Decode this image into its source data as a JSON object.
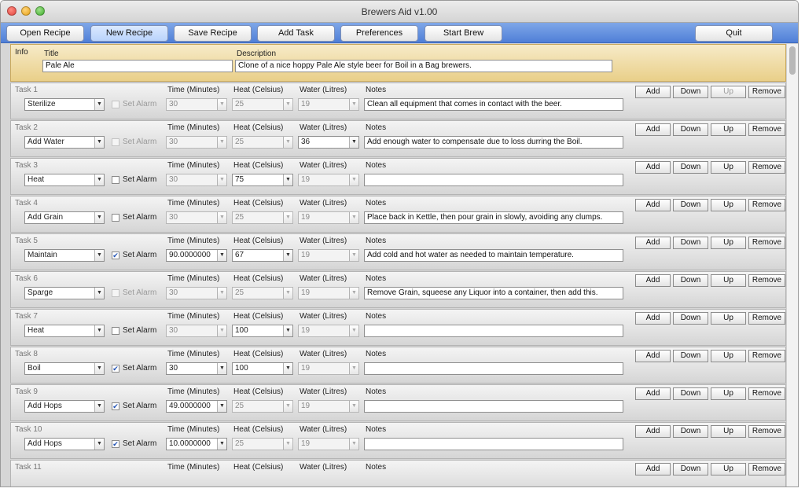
{
  "window": {
    "title": "Brewers Aid v1.00"
  },
  "toolbar": {
    "open_recipe": "Open Recipe",
    "new_recipe": "New Recipe",
    "save_recipe": "Save Recipe",
    "add_task": "Add Task",
    "preferences": "Preferences",
    "start_brew": "Start Brew",
    "quit": "Quit"
  },
  "info": {
    "section_label": "Info",
    "title_label": "Title",
    "title_value": "Pale Ale",
    "description_label": "Description",
    "description_value": "Clone of a nice hoppy Pale Ale style beer for Boil in a Bag brewers."
  },
  "labels": {
    "set_alarm": "Set Alarm",
    "time": "Time (Minutes)",
    "heat": "Heat (Celsius)",
    "water": "Water (Litres)",
    "notes": "Notes",
    "add": "Add",
    "down": "Down",
    "up": "Up",
    "remove": "Remove"
  },
  "tasks": [
    {
      "label": "Task 1",
      "type": "Sterilize",
      "alarm": false,
      "alarm_enabled": false,
      "time": "30",
      "time_enabled": false,
      "heat": "25",
      "heat_enabled": false,
      "water": "19",
      "water_enabled": false,
      "notes": "Clean all equipment that comes in contact with the beer.",
      "up_enabled": false
    },
    {
      "label": "Task 2",
      "type": "Add Water",
      "alarm": false,
      "alarm_enabled": false,
      "time": "30",
      "time_enabled": false,
      "heat": "25",
      "heat_enabled": false,
      "water": "36",
      "water_enabled": true,
      "notes": "Add enough water to compensate due to loss durring the Boil.",
      "up_enabled": true
    },
    {
      "label": "Task 3",
      "type": "Heat",
      "alarm": false,
      "alarm_enabled": true,
      "time": "30",
      "time_enabled": false,
      "heat": "75",
      "heat_enabled": true,
      "water": "19",
      "water_enabled": false,
      "notes": "",
      "up_enabled": true
    },
    {
      "label": "Task 4",
      "type": "Add Grain",
      "alarm": false,
      "alarm_enabled": true,
      "time": "30",
      "time_enabled": false,
      "heat": "25",
      "heat_enabled": false,
      "water": "19",
      "water_enabled": false,
      "notes": "Place back in Kettle, then pour grain in slowly, avoiding any clumps.",
      "up_enabled": true
    },
    {
      "label": "Task 5",
      "type": "Maintain",
      "alarm": true,
      "alarm_enabled": true,
      "time": "90.0000000",
      "time_enabled": true,
      "heat": "67",
      "heat_enabled": true,
      "water": "19",
      "water_enabled": false,
      "notes": "Add cold and hot water as needed to maintain temperature.",
      "up_enabled": true
    },
    {
      "label": "Task 6",
      "type": "Sparge",
      "alarm": false,
      "alarm_enabled": false,
      "time": "30",
      "time_enabled": false,
      "heat": "25",
      "heat_enabled": false,
      "water": "19",
      "water_enabled": false,
      "notes": "Remove Grain, squeese any Liquor into a container, then add this.",
      "up_enabled": true
    },
    {
      "label": "Task 7",
      "type": "Heat",
      "alarm": false,
      "alarm_enabled": true,
      "time": "30",
      "time_enabled": false,
      "heat": "100",
      "heat_enabled": true,
      "water": "19",
      "water_enabled": false,
      "notes": "",
      "up_enabled": true
    },
    {
      "label": "Task 8",
      "type": "Boil",
      "alarm": true,
      "alarm_enabled": true,
      "time": "30",
      "time_enabled": true,
      "heat": "100",
      "heat_enabled": true,
      "water": "19",
      "water_enabled": false,
      "notes": "",
      "up_enabled": true
    },
    {
      "label": "Task 9",
      "type": "Add Hops",
      "alarm": true,
      "alarm_enabled": true,
      "time": "49.0000000",
      "time_enabled": true,
      "heat": "25",
      "heat_enabled": false,
      "water": "19",
      "water_enabled": false,
      "notes": "",
      "up_enabled": true
    },
    {
      "label": "Task 10",
      "type": "Add Hops",
      "alarm": true,
      "alarm_enabled": true,
      "time": "10.0000000",
      "time_enabled": true,
      "heat": "25",
      "heat_enabled": false,
      "water": "19",
      "water_enabled": false,
      "notes": "",
      "up_enabled": true
    },
    {
      "label": "Task 11",
      "partial": true,
      "up_enabled": true
    }
  ]
}
